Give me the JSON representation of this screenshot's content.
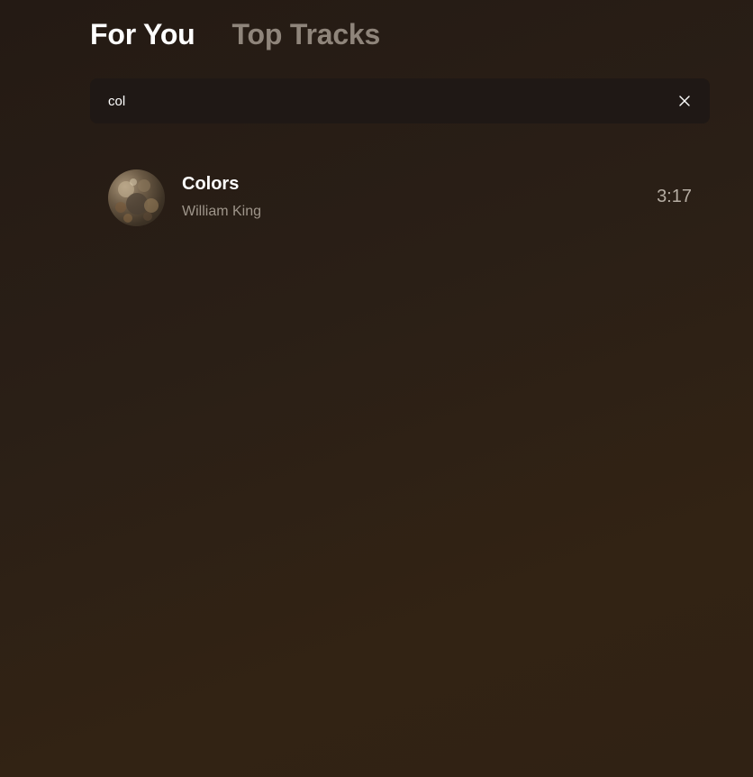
{
  "tabs": [
    {
      "label": "For You",
      "active": true
    },
    {
      "label": "Top Tracks",
      "active": false
    }
  ],
  "search": {
    "value": "col",
    "clear_icon": "close-icon"
  },
  "tracks": [
    {
      "title": "Colors",
      "artist": "William King",
      "duration": "3:17",
      "cover_icon": "album-cover"
    }
  ],
  "colors": {
    "background_start": "#241a14",
    "background_end": "#322314",
    "search_bg": "#1f1815",
    "inactive_tab": "#8f857b",
    "artist_text": "#9e958a"
  }
}
